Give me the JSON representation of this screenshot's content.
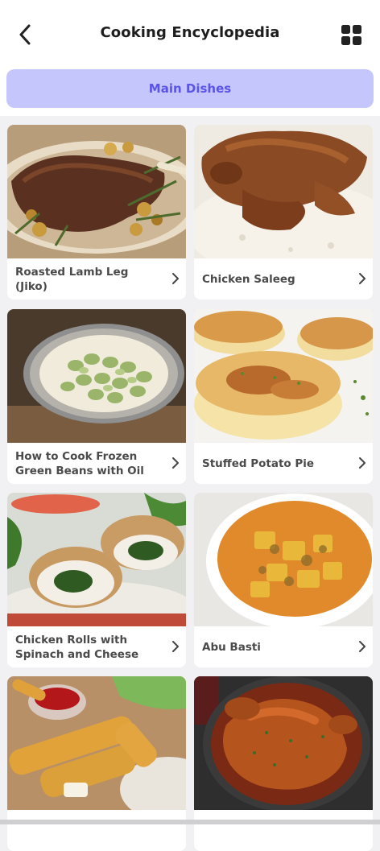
{
  "header": {
    "title": "Cooking Encyclopedia",
    "back_icon": "chevron-left-icon",
    "layout_icon": "grid-icon"
  },
  "category": {
    "label": "Main Dishes",
    "background": "#c5c6fb",
    "text_color": "#5a55ea"
  },
  "dishes": [
    {
      "name": "Roasted Lamb Leg (Jiko)"
    },
    {
      "name": "Chicken Saleeg"
    },
    {
      "name": "How to Cook Frozen Green Beans with Oil"
    },
    {
      "name": "Stuffed Potato Pie"
    },
    {
      "name": "Chicken Rolls with Spinach and Cheese"
    },
    {
      "name": "Abu Basti"
    },
    {
      "name": ""
    },
    {
      "name": ""
    }
  ]
}
